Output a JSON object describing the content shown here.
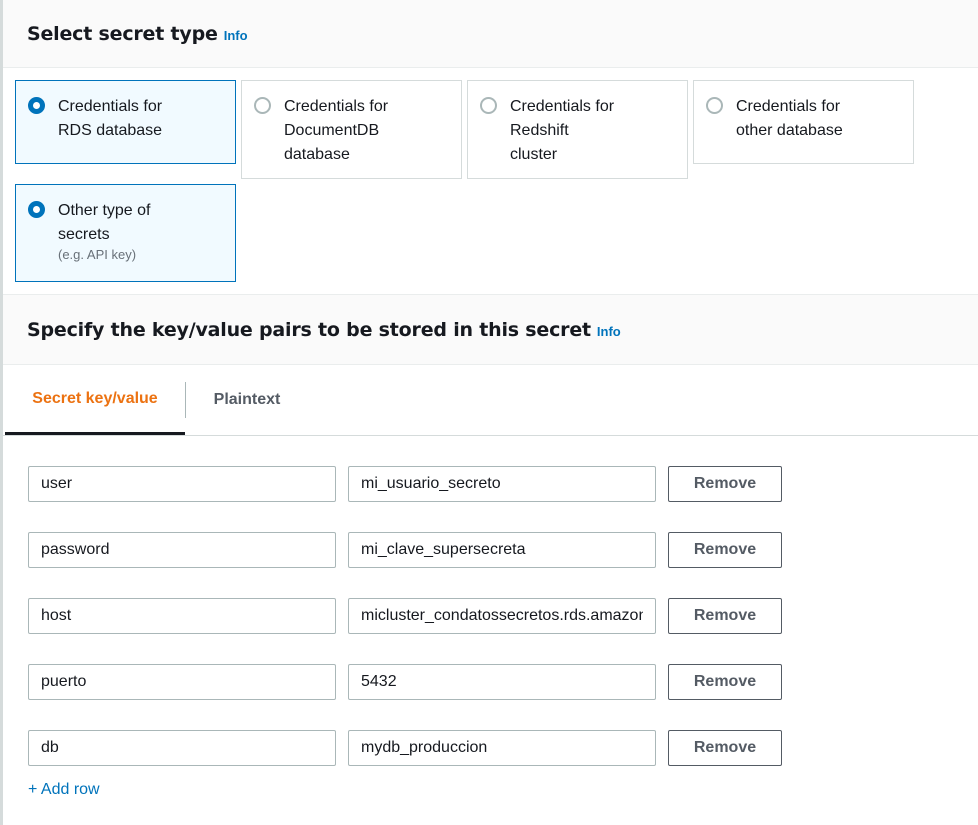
{
  "section1": {
    "title": "Select secret type",
    "info": "Info"
  },
  "secret_types": [
    {
      "label": "Credentials for RDS database",
      "lines": [
        "Credentials for",
        "RDS database"
      ],
      "selected": false
    },
    {
      "label": "Credentials for DocumentDB database",
      "lines": [
        "Credentials for",
        "DocumentDB",
        "database"
      ],
      "selected": false
    },
    {
      "label": "Credentials for Redshift cluster",
      "lines": [
        "Credentials for",
        "Redshift",
        "cluster"
      ],
      "selected": false
    },
    {
      "label": "Credentials for other database",
      "lines": [
        "Credentials for",
        "other database"
      ],
      "selected": false
    },
    {
      "label": "Other type of secrets",
      "lines": [
        "Other type of",
        "secrets"
      ],
      "description": "(e.g. API key)",
      "selected": true
    }
  ],
  "section2": {
    "title": "Specify the key/value pairs to be stored in this secret",
    "info": "Info"
  },
  "tabs": [
    {
      "label": "Secret key/value",
      "active": true
    },
    {
      "label": "Plaintext",
      "active": false
    }
  ],
  "rows": [
    {
      "key": "user",
      "value": "mi_usuario_secreto",
      "remove": "Remove"
    },
    {
      "key": "password",
      "value": "mi_clave_supersecreta",
      "remove": "Remove"
    },
    {
      "key": "host",
      "value": "micluster_condatossecretos.rds.amazonaws.com",
      "remove": "Remove"
    },
    {
      "key": "puerto",
      "value": "5432",
      "remove": "Remove"
    },
    {
      "key": "db",
      "value": "mydb_produccion",
      "remove": "Remove"
    }
  ],
  "add_row": "+ Add row"
}
